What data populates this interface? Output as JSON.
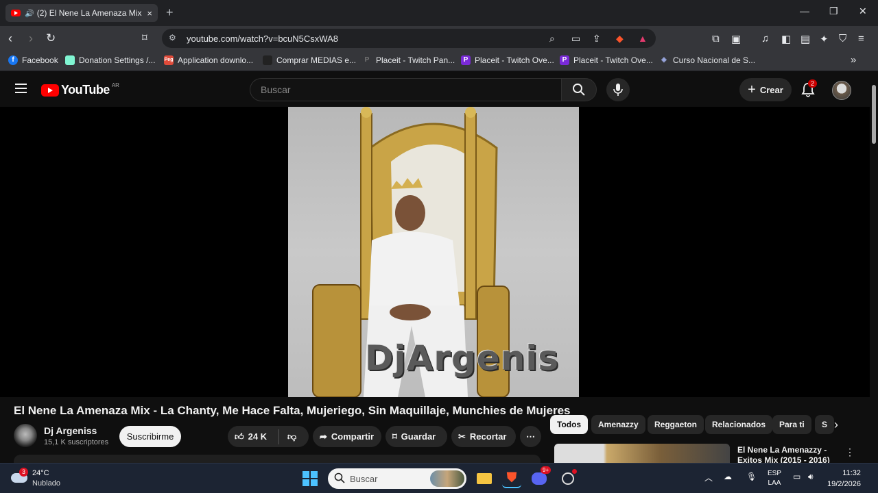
{
  "browser": {
    "tab": {
      "title": "(2) El Nene La Amenaza Mix -",
      "close": "×"
    },
    "new_tab": "+",
    "window": {
      "minimize": "—",
      "maximize": "❐",
      "close": "✕"
    },
    "url": "youtube.com/watch?v=bcuN5CsxWA8",
    "bookmarks": [
      {
        "label": "Facebook",
        "icon": "facebook-icon",
        "color": "#1877f2"
      },
      {
        "label": "Donation Settings /...",
        "icon": "streamlabs-icon",
        "color": "#80f5d2"
      },
      {
        "label": "Application downlo...",
        "icon": "app-icon",
        "color": "#e04b3a"
      },
      {
        "label": "Comprar MEDIAS e...",
        "icon": "shop-icon",
        "color": "#222222"
      },
      {
        "label": "Placeit - Twitch Pan...",
        "icon": "placeit-icon",
        "color": "#444444"
      },
      {
        "label": "Placeit - Twitch Ove...",
        "icon": "placeit-p-icon",
        "color": "#7a2ad8"
      },
      {
        "label": "Placeit - Twitch Ove...",
        "icon": "placeit-p-icon",
        "color": "#7a2ad8"
      },
      {
        "label": "Curso Nacional de S...",
        "icon": "course-icon",
        "color": "#6a7ab8"
      }
    ],
    "bookmarks_more": "»"
  },
  "youtube": {
    "logo_text": "YouTube",
    "country": "AR",
    "search_placeholder": "Buscar",
    "create_label": "Crear",
    "notifications": "2",
    "watermark": "DjArgenis",
    "video_title": "El Nene La Amenaza Mix - La Chanty, Me Hace Falta, Mujeriego, Sin Maquillaje, Munchies de Mujeres",
    "channel": {
      "name": "Dj Argeniss",
      "subscribers": "15,1 K suscriptores"
    },
    "subscribe_label": "Suscribirme",
    "likes": "24 K",
    "share_label": "Compartir",
    "save_label": "Guardar",
    "clip_label": "Recortar",
    "chips": [
      "Todos",
      "Amenazzy",
      "Reggaeton",
      "Relacionados",
      "Para ti",
      "S"
    ],
    "recommended": {
      "title": "El Nene La Amenazzy - Exitos Mix (2015 - 2016)"
    }
  },
  "taskbar": {
    "weather_badge": "3",
    "temperature": "24°C",
    "condition": "Nublado",
    "search_label": "Buscar",
    "discord_badge": "9+",
    "language": "ESP",
    "layout": "LAA",
    "time": "11:32",
    "date": "19/2/2026"
  }
}
